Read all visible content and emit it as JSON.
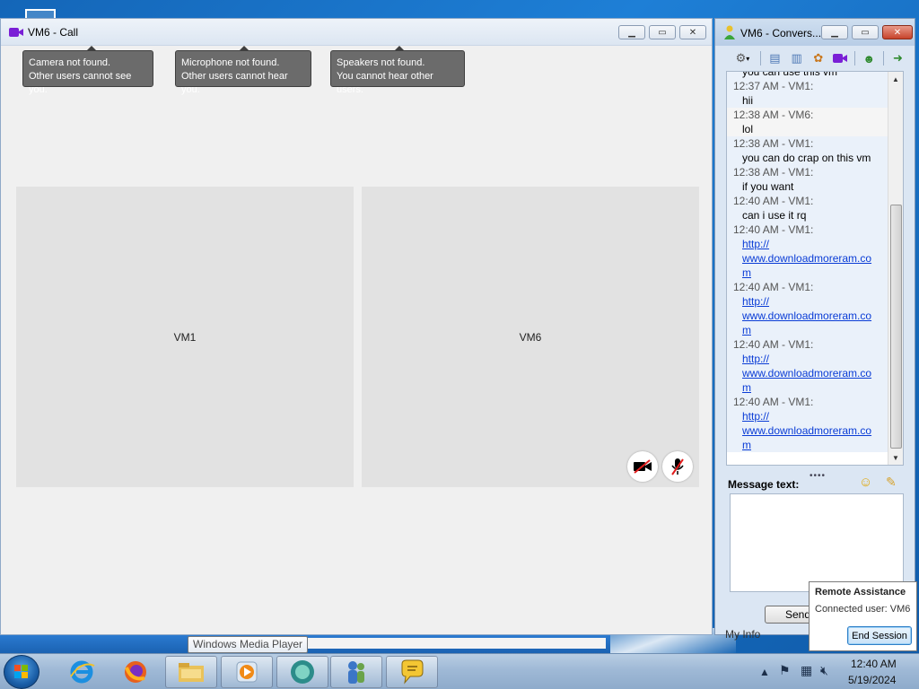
{
  "call_window": {
    "title": "VM6 - Call",
    "notices": [
      {
        "line1": "Camera not found.",
        "line2": "Other users cannot see you."
      },
      {
        "line1": "Microphone not found.",
        "line2": "Other users cannot hear you."
      },
      {
        "line1": "Speakers not found.",
        "line2": "You cannot hear other users."
      }
    ],
    "participants": [
      "VM1",
      "VM6"
    ]
  },
  "conversation": {
    "title": "VM6 - Convers...",
    "messages": [
      {
        "meta": "",
        "lines": [
          {
            "text": "you can use this vm",
            "link": false
          }
        ]
      },
      {
        "meta": "12:37 AM - VM1:",
        "lines": [
          {
            "text": "hii",
            "link": false
          }
        ]
      },
      {
        "meta": "12:38 AM - VM6:",
        "lines": [
          {
            "text": "lol",
            "link": false
          }
        ]
      },
      {
        "meta": "12:38 AM - VM1:",
        "lines": [
          {
            "text": "you can do crap on this vm",
            "link": false
          }
        ]
      },
      {
        "meta": "12:38 AM - VM1:",
        "lines": [
          {
            "text": "if you want",
            "link": false
          }
        ]
      },
      {
        "meta": "12:40 AM - VM1:",
        "lines": [
          {
            "text": "can i use it rq",
            "link": false
          }
        ]
      },
      {
        "meta": "12:40 AM - VM1:",
        "lines": [
          {
            "text": "http://",
            "link": true
          },
          {
            "text": "www.downloadmoreram.co",
            "link": true
          },
          {
            "text": "m",
            "link": true
          }
        ]
      },
      {
        "meta": "12:40 AM - VM1:",
        "lines": [
          {
            "text": "http://",
            "link": true
          },
          {
            "text": "www.downloadmoreram.co",
            "link": true
          },
          {
            "text": "m",
            "link": true
          }
        ]
      },
      {
        "meta": "12:40 AM - VM1:",
        "lines": [
          {
            "text": "http://",
            "link": true
          },
          {
            "text": "www.downloadmoreram.co",
            "link": true
          },
          {
            "text": "m",
            "link": true
          }
        ]
      },
      {
        "meta": "12:40 AM - VM1:",
        "lines": [
          {
            "text": "http://",
            "link": true
          },
          {
            "text": "www.downloadmoreram.co",
            "link": true
          },
          {
            "text": "m",
            "link": true
          }
        ]
      }
    ],
    "message_label": "Message text:",
    "message_value": "",
    "send_label": "Send",
    "my_info_label": "My Info"
  },
  "remote_assistance": {
    "title": "Remote Assistance",
    "connected_user": "Connected user:  VM6",
    "end_label": "End Session"
  },
  "taskbar": {
    "tooltip": "Windows Media Player",
    "time": "12:40 AM",
    "date": "5/19/2024"
  },
  "colors": {
    "accent_purple": "#7a1fd6",
    "link_blue": "#0a3cd6",
    "notice_gray": "#6b6b6b",
    "close_red": "#c7432b"
  }
}
